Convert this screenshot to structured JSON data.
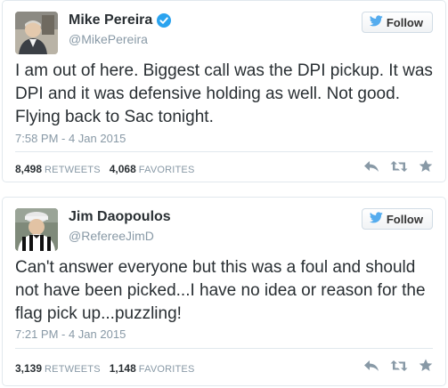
{
  "tweets": [
    {
      "name": "Mike Pereira",
      "handle": "@MikePereira",
      "verified": true,
      "follow_label": "Follow",
      "text": "I am out of here. Biggest call was the DPI pickup. It was DPI and it was defensive holding as well. Not good. Flying back to Sac tonight.",
      "timestamp": "7:58 PM - 4 Jan 2015",
      "retweets_count": "8,498",
      "retweets_label": "RETWEETS",
      "favorites_count": "4,068",
      "favorites_label": "FAVORITES"
    },
    {
      "name": "Jim Daopoulos",
      "handle": "@RefereeJimD",
      "verified": false,
      "follow_label": "Follow",
      "text": "Can't answer everyone but this was a foul and should not have been picked...I have no idea or reason for the flag pick up...puzzling!",
      "timestamp": "7:21 PM - 4 Jan 2015",
      "retweets_count": "3,139",
      "retweets_label": "RETWEETS",
      "favorites_count": "1,148",
      "favorites_label": "FAVORITES"
    }
  ],
  "colors": {
    "text": "#292f33",
    "muted": "#8899a6",
    "twitter_blue": "#55acee",
    "verified_blue": "#2aa3ef",
    "border": "#e1e8ed"
  }
}
